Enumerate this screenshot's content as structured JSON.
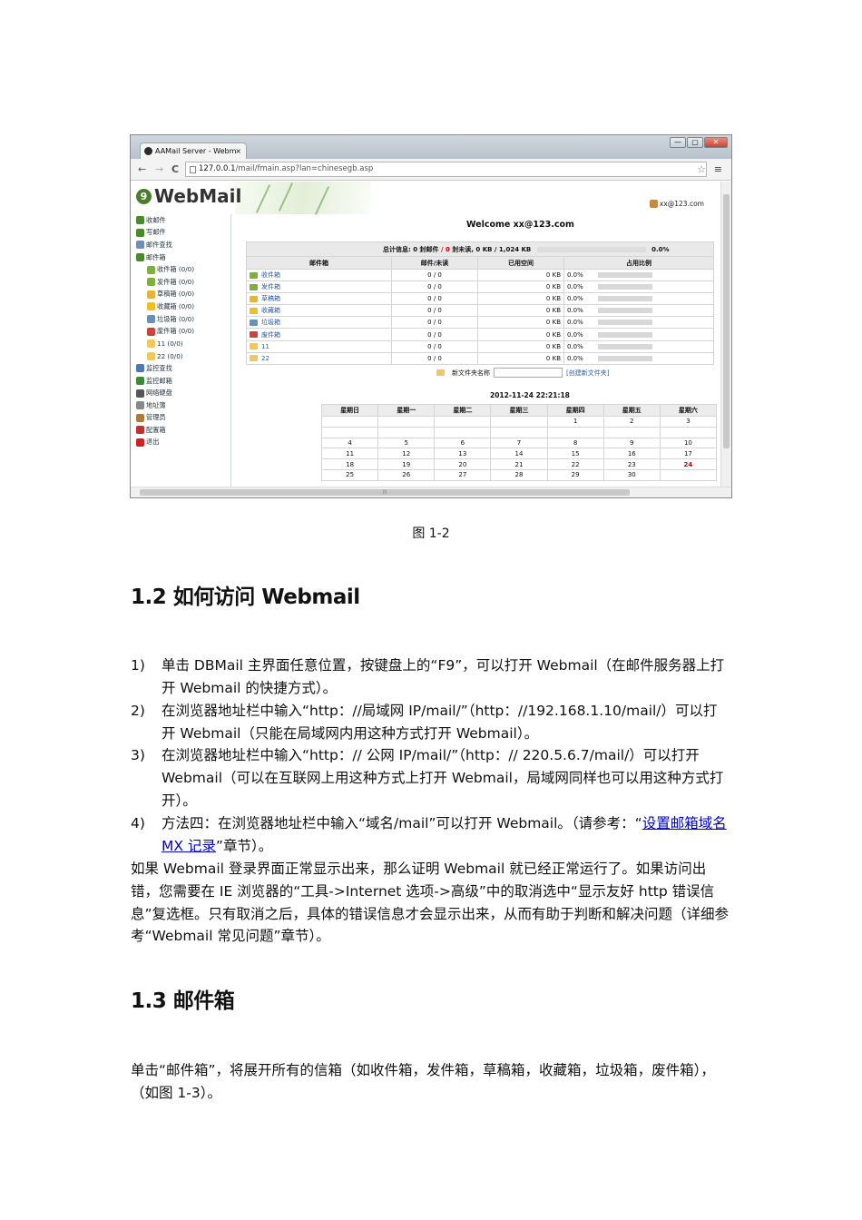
{
  "browser": {
    "tab_title": "AAMail Server - Webm",
    "tab_close": "×",
    "window_buttons": [
      "—",
      "▢",
      "✕"
    ],
    "nav": {
      "back": "←",
      "forward": "→",
      "reload": "C"
    },
    "url_host": "127.0.0.1",
    "url_path": "/mail/fmain.asp?lan=chinesegb.asp",
    "star": "☆",
    "menu": "≡"
  },
  "webmail": {
    "logo": "WebMail",
    "user": "xx@123.com",
    "welcome": "Welcome xx@123.com",
    "sidebar": [
      {
        "label": "收邮件",
        "color": "#4a8a2a",
        "sub": false
      },
      {
        "label": "写邮件",
        "color": "#4a8a2a",
        "sub": false
      },
      {
        "label": "邮件查找",
        "color": "#6b8fb5",
        "sub": false
      },
      {
        "label": "邮件箱",
        "color": "#4a8a2a",
        "sub": false
      },
      {
        "label": "收件箱 (0/0)",
        "color": "#7fb03f",
        "sub": true
      },
      {
        "label": "发件箱 (0/0)",
        "color": "#7fb03f",
        "sub": true
      },
      {
        "label": "草稿箱 (0/0)",
        "color": "#e5b53a",
        "sub": true
      },
      {
        "label": "收藏箱 (0/0)",
        "color": "#f0c020",
        "sub": true
      },
      {
        "label": "垃圾箱 (0/0)",
        "color": "#6b8fb5",
        "sub": true
      },
      {
        "label": "废件箱 (0/0)",
        "color": "#d04040",
        "sub": true
      },
      {
        "label": "11 (0/0)",
        "color": "#f0c860",
        "sub": true
      },
      {
        "label": "22 (0/0)",
        "color": "#f0c860",
        "sub": true
      },
      {
        "label": "监控查找",
        "color": "#4a7ab5",
        "sub": false
      },
      {
        "label": "监控邮箱",
        "color": "#3a8a3a",
        "sub": false
      },
      {
        "label": "网络硬盘",
        "color": "#555555",
        "sub": false
      },
      {
        "label": "地址簿",
        "color": "#888888",
        "sub": false
      },
      {
        "label": "管理员",
        "color": "#b07a3a",
        "sub": false
      },
      {
        "label": "配置箱",
        "color": "#c03030",
        "sub": false
      },
      {
        "label": "退出",
        "color": "#d02020",
        "sub": false
      }
    ],
    "summary": {
      "label": "总计信息:",
      "mails": "0 封邮件",
      "sep": "/",
      "unread_num": "0",
      "unread": "封未读,",
      "size": "0 KB / 1,024 KB",
      "pct": "0.0%"
    },
    "headers": [
      "邮件箱",
      "邮件/未读",
      "已用空间",
      "占用比例"
    ],
    "rows": [
      {
        "name": "收件箱",
        "color": "#7fb03f",
        "count": "0 / 0",
        "size": "0 KB",
        "pct": "0.0%"
      },
      {
        "name": "发件箱",
        "color": "#7fb03f",
        "count": "0 / 0",
        "size": "0 KB",
        "pct": "0.0%"
      },
      {
        "name": "草稿箱",
        "color": "#e5b53a",
        "count": "0 / 0",
        "size": "0 KB",
        "pct": "0.0%"
      },
      {
        "name": "收藏箱",
        "color": "#f0c020",
        "count": "0 / 0",
        "size": "0 KB",
        "pct": "0.0%"
      },
      {
        "name": "垃圾箱",
        "color": "#6b8fb5",
        "count": "0 / 0",
        "size": "0 KB",
        "pct": "0.0%"
      },
      {
        "name": "废件箱",
        "color": "#d04040",
        "count": "0 / 0",
        "size": "0 KB",
        "pct": "0.0%"
      },
      {
        "name": "11",
        "color": "#f0c860",
        "count": "0 / 0",
        "size": "0 KB",
        "pct": "0.0%"
      },
      {
        "name": "22",
        "color": "#f0c860",
        "count": "0 / 0",
        "size": "0 KB",
        "pct": "0.0%"
      }
    ],
    "new_folder_label": "新文件夹名称",
    "new_folder_button": "[创建新文件夹]",
    "datetime": "2012-11-24 22:21:18",
    "weekdays": [
      "星期日",
      "星期一",
      "星期二",
      "星期三",
      "星期四",
      "星期五",
      "星期六"
    ],
    "calendar": [
      [
        "",
        "",
        "",
        "",
        "1",
        "2",
        "3"
      ],
      [
        "4",
        "5",
        "6",
        "7",
        "8",
        "9",
        "10"
      ],
      [
        "11",
        "12",
        "13",
        "14",
        "15",
        "16",
        "17"
      ],
      [
        "18",
        "19",
        "20",
        "21",
        "22",
        "23",
        "24"
      ],
      [
        "25",
        "26",
        "27",
        "28",
        "29",
        "30",
        ""
      ]
    ],
    "today": "24",
    "hscroll_grip": "III"
  },
  "doc": {
    "caption": "图  1-2",
    "h12": "1.2  如何访问 Webmail",
    "items": [
      {
        "num": "1)",
        "text": "单击 DBMail 主界面任意位置，按键盘上的“F9”，可以打开 Webmail（在邮件服务器上打开 Webmail 的快捷方式）。"
      },
      {
        "num": "2)",
        "text": "在浏览器地址栏中输入“http：//局域网 IP/mail/”（http：//192.168.1.10/mail/）可以打开 Webmail（只能在局域网内用这种方式打开 Webmail）。"
      },
      {
        "num": "3)",
        "text": "在浏览器地址栏中输入“http：// 公网 IP/mail/”（http：// 220.5.6.7/mail/）可以打开 Webmail（可以在互联网上用这种方式上打开 Webmail，局域网同样也可以用这种方式打开）。"
      },
      {
        "num": "4)",
        "text_before": "方法四：在浏览器地址栏中输入“域名/mail”可以打开 Webmail。（请参考：“",
        "link": "设置邮箱域名 MX 记录",
        "text_after": "”章节）。"
      }
    ],
    "para1": "如果 Webmail 登录界面正常显示出来，那么证明 Webmail 就已经正常运行了。如果访问出错，您需要在 IE 浏览器的“工具->Internet 选项->高级”中的取消选中“显示友好 http 错误信息”复选框。只有取消之后，具体的错误信息才会显示出来，从而有助于判断和解决问题（详细参考“Webmail 常见问题”章节）。",
    "h13": "1.3  邮件箱",
    "para2": "单击“邮件箱”，将展开所有的信箱（如收件箱，发件箱，草稿箱，收藏箱，垃圾箱，废件箱），（如图  1-3）。"
  }
}
